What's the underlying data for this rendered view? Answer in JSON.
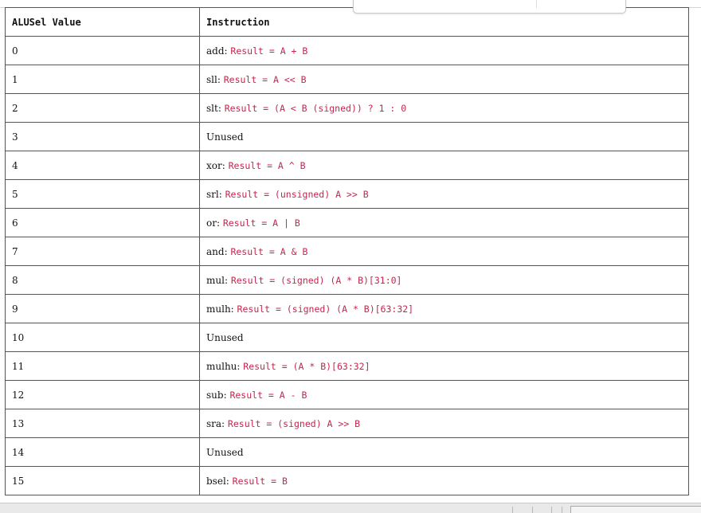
{
  "table": {
    "headers": [
      "ALUSel Value",
      "Instruction"
    ],
    "rows": [
      {
        "value": "0",
        "mnemonic": "add:",
        "code": "Result = A + B"
      },
      {
        "value": "1",
        "mnemonic": "sll:",
        "code": "Result = A << B"
      },
      {
        "value": "2",
        "mnemonic": "slt:",
        "code": "Result = (A < B (signed)) ? 1 : 0"
      },
      {
        "value": "3",
        "mnemonic": "Unused",
        "code": ""
      },
      {
        "value": "4",
        "mnemonic": "xor:",
        "code": "Result = A ^ B"
      },
      {
        "value": "5",
        "mnemonic": "srl:",
        "code": "Result = (unsigned) A >> B"
      },
      {
        "value": "6",
        "mnemonic": "or:",
        "code": "Result = A | B"
      },
      {
        "value": "7",
        "mnemonic": "and:",
        "code": "Result = A & B"
      },
      {
        "value": "8",
        "mnemonic": "mul:",
        "code": "Result = (signed) (A * B)[31:0]"
      },
      {
        "value": "9",
        "mnemonic": "mulh:",
        "code": "Result = (signed) (A * B)[63:32]"
      },
      {
        "value": "10",
        "mnemonic": "Unused",
        "code": ""
      },
      {
        "value": "11",
        "mnemonic": "mulhu:",
        "code": "Result = (A * B)[63:32]"
      },
      {
        "value": "12",
        "mnemonic": "sub:",
        "code": "Result = A - B"
      },
      {
        "value": "13",
        "mnemonic": "sra:",
        "code": "Result = (signed) A >> B"
      },
      {
        "value": "14",
        "mnemonic": "Unused",
        "code": ""
      },
      {
        "value": "15",
        "mnemonic": "bsel:",
        "code": "Result = B"
      }
    ]
  },
  "colors": {
    "code_text": "#c7254e",
    "border": "#555555"
  }
}
